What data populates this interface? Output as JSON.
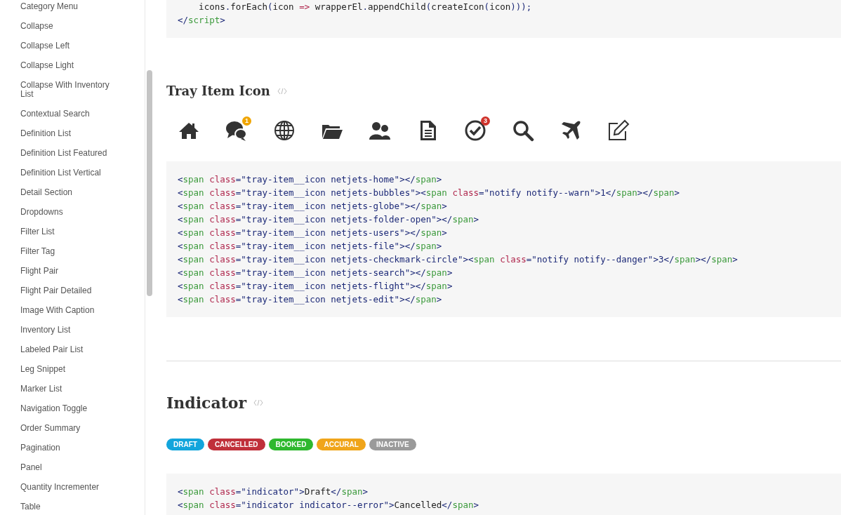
{
  "sidebar": {
    "items": [
      "Category Menu",
      "Collapse",
      "Collapse Left",
      "Collapse Light",
      "Collapse With Inventory List",
      "Contextual Search",
      "Definition List",
      "Definition List Featured",
      "Definition List Vertical",
      "Detail Section",
      "Dropdowns",
      "Filter List",
      "Filter Tag",
      "Flight Pair",
      "Flight Pair Detailed",
      "Image With Caption",
      "Inventory List",
      "Labeled Pair List",
      "Leg Snippet",
      "Marker List",
      "Navigation Toggle",
      "Order Summary",
      "Pagination",
      "Panel",
      "Quantity Incrementer",
      "Table"
    ]
  },
  "top_code": {
    "lines": [
      "    icons.forEach(icon => wrapperEl.appendChild(createIcon(icon)));",
      "</script>"
    ]
  },
  "tray_section": {
    "title": "Tray Item Icon",
    "icons": [
      {
        "kind": "home"
      },
      {
        "kind": "bubbles",
        "badge": "1",
        "color": "#f0a500"
      },
      {
        "kind": "globe"
      },
      {
        "kind": "folder"
      },
      {
        "kind": "users"
      },
      {
        "kind": "file"
      },
      {
        "kind": "check",
        "badge": "3",
        "color": "#d0342c"
      },
      {
        "kind": "search"
      },
      {
        "kind": "flight"
      },
      {
        "kind": "edit"
      }
    ],
    "code": [
      "<span class=\"tray-item__icon netjets-home\"></span>",
      "<span class=\"tray-item__icon netjets-bubbles\"><span class=\"notify notify--warn\">1</span></span>",
      "<span class=\"tray-item__icon netjets-globe\"></span>",
      "<span class=\"tray-item__icon netjets-folder-open\"></span>",
      "<span class=\"tray-item__icon netjets-users\"></span>",
      "<span class=\"tray-item__icon netjets-file\"></span>",
      "<span class=\"tray-item__icon netjets-checkmark-circle\"><span class=\"notify notify--danger\">3</span></span>",
      "<span class=\"tray-item__icon netjets-search\"></span>",
      "<span class=\"tray-item__icon netjets-flight\"></span>",
      "<span class=\"tray-item__icon netjets-edit\"></span>"
    ]
  },
  "indicator_section": {
    "title": "Indicator",
    "indicators": [
      {
        "label": "DRAFT",
        "color": "#12a5dc"
      },
      {
        "label": "CANCELLED",
        "color": "#c0303a"
      },
      {
        "label": "BOOKED",
        "color": "#2eb82e"
      },
      {
        "label": "ACCURAL",
        "color": "#f0a51a"
      },
      {
        "label": "INACTIVE",
        "color": "#9a9a9a"
      }
    ],
    "code": [
      "<span class=\"indicator\">Draft</span>",
      "<span class=\"indicator indicator--error\">Cancelled</span>"
    ]
  }
}
